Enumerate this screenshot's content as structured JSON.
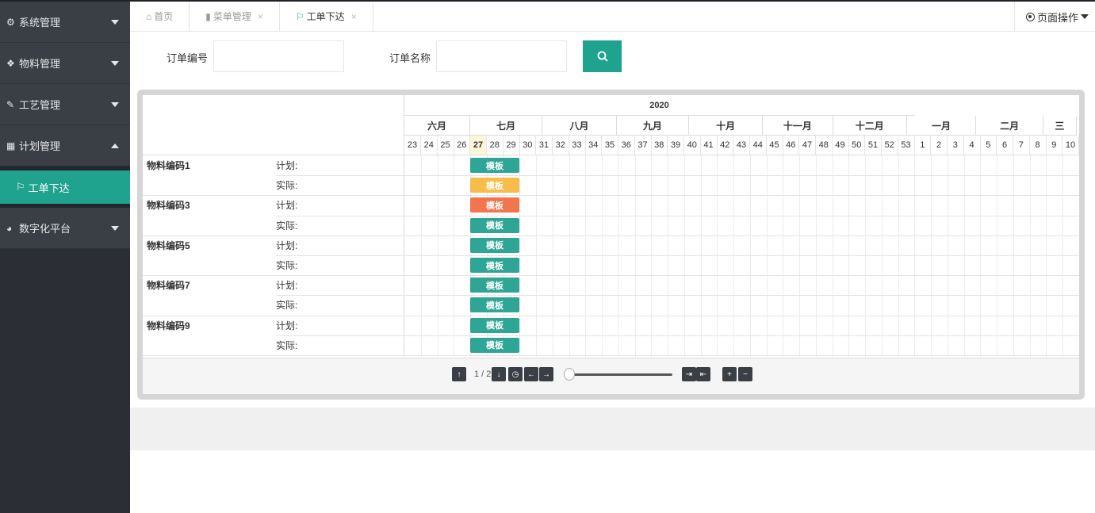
{
  "sidebar": {
    "items": [
      {
        "label": "系统管理",
        "icon": "gears-icon"
      },
      {
        "label": "物料管理",
        "icon": "cubes-icon"
      },
      {
        "label": "工艺管理",
        "icon": "wrench-icon"
      },
      {
        "label": "计划管理",
        "icon": "calendar-icon",
        "open": true
      },
      {
        "label": "数字化平台",
        "icon": "pie-chart-icon"
      }
    ],
    "active_subitem": "工单下达"
  },
  "tabs": [
    {
      "label": "首页",
      "icon": "home-icon"
    },
    {
      "label": "菜单管理",
      "icon": "file-icon"
    },
    {
      "label": "工单下达",
      "icon": "flag-icon",
      "active": true
    }
  ],
  "page_ops_label": "页面操作",
  "search": {
    "order_no_label": "订单编号",
    "order_no_value": "",
    "order_name_label": "订单名称",
    "order_name_value": ""
  },
  "gantt": {
    "year": "2020",
    "months": [
      "六月",
      "七月",
      "八月",
      "九月",
      "十月",
      "十一月",
      "十二月",
      "一月",
      "二月",
      "三"
    ],
    "weeks": [
      "23",
      "24",
      "25",
      "26",
      "27",
      "28",
      "29",
      "30",
      "31",
      "32",
      "33",
      "34",
      "35",
      "36",
      "37",
      "38",
      "39",
      "40",
      "41",
      "42",
      "43",
      "44",
      "45",
      "46",
      "47",
      "48",
      "49",
      "50",
      "51",
      "52",
      "53",
      "1",
      "2",
      "3",
      "4",
      "5",
      "6",
      "7",
      "8",
      "9",
      "10"
    ],
    "today_week": "27",
    "rows": [
      {
        "material": "物料编码1",
        "kind": "计划:",
        "task": "模板",
        "color": "#2fa596"
      },
      {
        "material": "",
        "kind": "实际:",
        "task": "模板",
        "color": "#f6bd4a"
      },
      {
        "material": "物料编码3",
        "kind": "计划:",
        "task": "模板",
        "color": "#f2754e"
      },
      {
        "material": "",
        "kind": "实际:",
        "task": "模板",
        "color": "#2fa596"
      },
      {
        "material": "物料编码5",
        "kind": "计划:",
        "task": "模板",
        "color": "#2fa596"
      },
      {
        "material": "",
        "kind": "实际:",
        "task": "模板",
        "color": "#2fa596"
      },
      {
        "material": "物料编码7",
        "kind": "计划:",
        "task": "模板",
        "color": "#2fa596"
      },
      {
        "material": "",
        "kind": "实际:",
        "task": "模板",
        "color": "#2fa596"
      },
      {
        "material": "物料编码9",
        "kind": "计划:",
        "task": "模板",
        "color": "#2fa596"
      },
      {
        "material": "",
        "kind": "实际:",
        "task": "模板",
        "color": "#2fa596"
      }
    ],
    "page": "1 / 2",
    "controls": [
      "↑",
      "↓",
      "◷",
      "←",
      "→",
      "⇥",
      "⇤",
      "+",
      "−"
    ]
  },
  "colors": {
    "accent": "#1fa28e",
    "sidebar_bg": "#2b2e35"
  }
}
